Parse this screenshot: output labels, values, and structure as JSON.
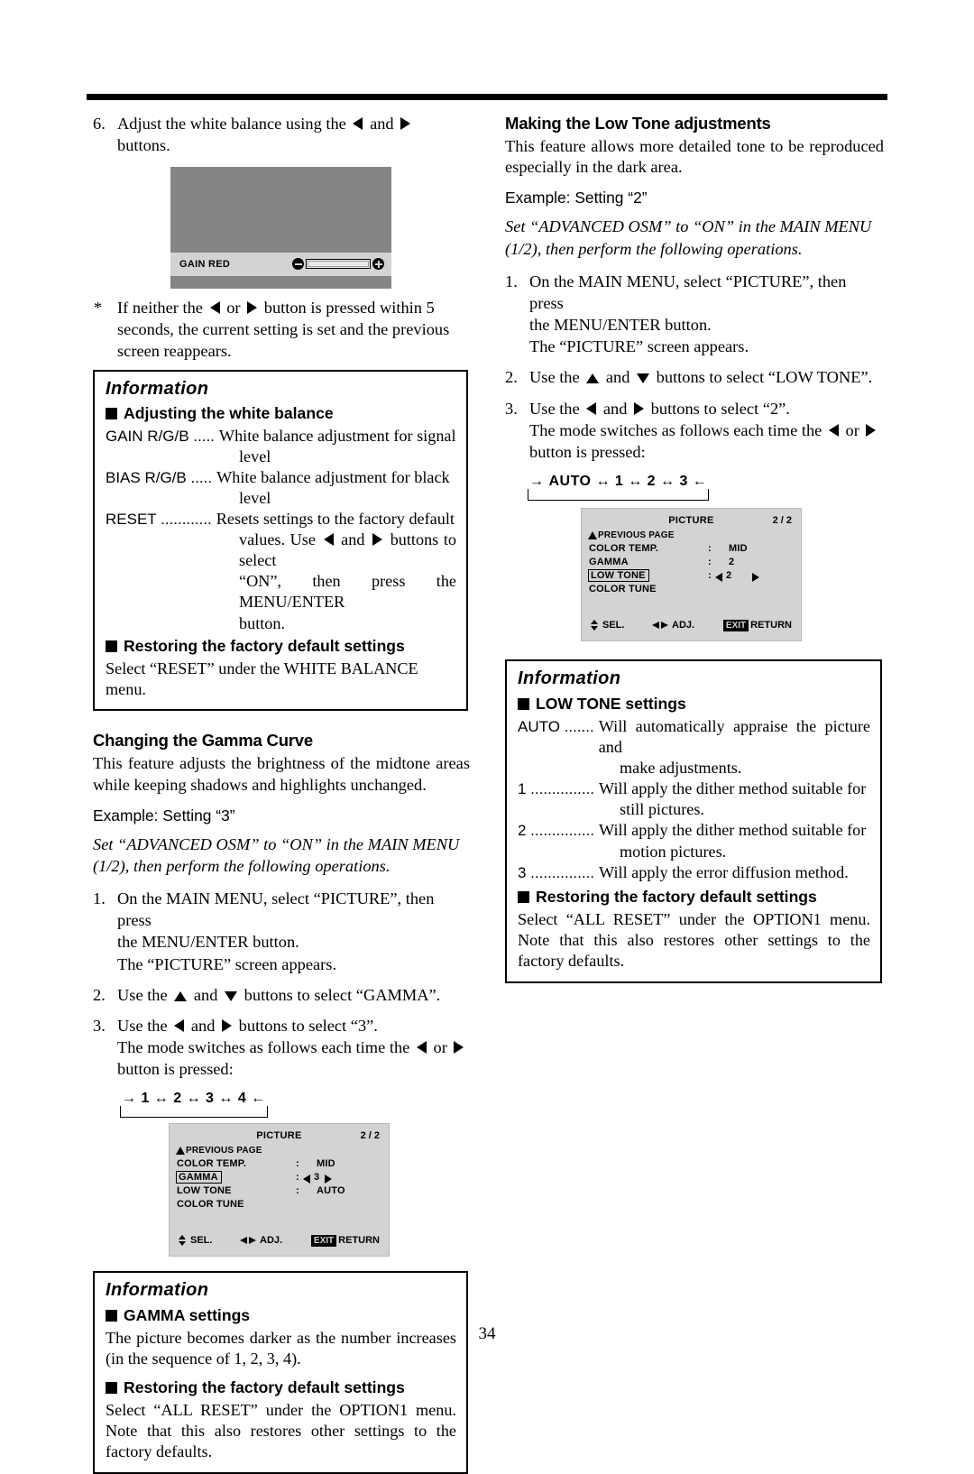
{
  "page": {
    "number": "34"
  },
  "left_column": {
    "step6": {
      "num": "6.",
      "text_a": "Adjust the white balance using the",
      "text_b": "and",
      "text_c": "buttons."
    },
    "gain_screen": {
      "label": "GAIN RED",
      "minus_icon": "minus-circle-icon",
      "plus_icon": "plus-circle-icon"
    },
    "star_note": {
      "star": "*",
      "line1_a": "If neither the",
      "line1_b": "or",
      "line1_c": "button is pressed within 5 seconds,",
      "line2": "the current setting is set and the previous screen reappears."
    },
    "info_white_balance": {
      "title": "Information",
      "heading": "Adjusting the white balance",
      "rows": [
        {
          "term": "GAIN R/G/B .....",
          "desc": "White balance adjustment for signal",
          "cont": "level"
        },
        {
          "term": "BIAS R/G/B .....",
          "desc": "White balance adjustment for black",
          "cont": "level"
        },
        {
          "term": "RESET ............",
          "desc": "Resets settings to the factory default",
          "cont2_a": "values. Use",
          "cont2_b": "and",
          "cont2_c": "buttons to select",
          "cont3": "“ON”, then press the MENU/ENTER",
          "cont4": "button."
        }
      ],
      "heading2": "Restoring the factory default settings",
      "body2": "Select “RESET” under the WHITE BALANCE menu."
    },
    "gamma_section": {
      "heading": "Changing the Gamma Curve",
      "intro": "This feature adjusts the brightness of the midtone areas while keeping shadows and highlights unchanged.",
      "example": "Example: Setting “3”",
      "italic_line1": "Set “ADVANCED OSM” to “ON” in the MAIN MENU",
      "italic_line2": "(1/2), then perform the following operations.",
      "steps": [
        {
          "num": "1.",
          "line1": "On the MAIN MENU, select “PICTURE”, then press",
          "line2": "the MENU/ENTER button.",
          "line3": "The “PICTURE” screen appears."
        },
        {
          "num": "2.",
          "a": "Use the",
          "b": "and",
          "c": "buttons to select “GAMMA”."
        },
        {
          "num": "3.",
          "a": "Use the",
          "b": "and",
          "c": "buttons to select “3”.",
          "d": "The mode switches as follows each time the",
          "e": "or",
          "f": "button is pressed:"
        }
      ],
      "sequence": "1 ↔ 2 ↔ 3 ↔ 4"
    },
    "osd_gamma": {
      "title": "PICTURE",
      "page": "2 / 2",
      "previous_page": "PREVIOUS PAGE",
      "rows": [
        {
          "label": "COLOR TEMP.",
          "colon": ":",
          "value": "MID",
          "highlight": false,
          "arrows": false
        },
        {
          "label": "GAMMA",
          "colon": ":",
          "value": "3",
          "highlight": true,
          "arrows": true
        },
        {
          "label": "LOW TONE",
          "colon": ":",
          "value": "AUTO",
          "highlight": false,
          "arrows": false
        },
        {
          "label": "COLOR TUNE",
          "colon": "",
          "value": "",
          "highlight": false,
          "arrows": false
        }
      ],
      "footer": {
        "sel": "SEL.",
        "adj": "ADJ.",
        "exit_chip": "EXIT",
        "return": "RETURN"
      }
    },
    "info_gamma": {
      "title": "Information",
      "heading": "GAMMA settings",
      "body": "The picture becomes darker as the number increases (in the sequence of 1, 2, 3, 4).",
      "heading2": "Restoring the factory default settings",
      "body2": "Select “ALL RESET” under the OPTION1 menu. Note that this also restores other settings to the factory defaults."
    }
  },
  "right_column": {
    "lowtone_section": {
      "heading": "Making the Low Tone adjustments",
      "intro": "This feature allows more detailed tone to be reproduced especially in the dark area.",
      "example": "Example: Setting “2”",
      "italic_line1": "Set “ADVANCED OSM” to “ON” in the MAIN MENU",
      "italic_line2": "(1/2), then perform the following operations.",
      "steps": [
        {
          "num": "1.",
          "line1": "On the MAIN MENU, select “PICTURE”, then press",
          "line2": "the MENU/ENTER button.",
          "line3": "The “PICTURE” screen appears."
        },
        {
          "num": "2.",
          "a": "Use the",
          "b": "and",
          "c": "buttons to select “LOW TONE”."
        },
        {
          "num": "3.",
          "a": "Use the",
          "b": "and",
          "c": "buttons to select “2”.",
          "d": "The mode switches as follows each time the",
          "e": "or",
          "f": "button is pressed:"
        }
      ],
      "sequence": "AUTO ↔ 1 ↔ 2 ↔ 3"
    },
    "osd_lowtone": {
      "title": "PICTURE",
      "page": "2 / 2",
      "previous_page": "PREVIOUS PAGE",
      "rows": [
        {
          "label": "COLOR TEMP.",
          "colon": ":",
          "value": "MID",
          "highlight": false,
          "arrows": false
        },
        {
          "label": "GAMMA",
          "colon": ":",
          "value": "2",
          "highlight": false,
          "arrows": false
        },
        {
          "label": "LOW TONE",
          "colon": ":",
          "value": "2",
          "highlight": true,
          "arrows": true
        },
        {
          "label": "COLOR TUNE",
          "colon": "",
          "value": "",
          "highlight": false,
          "arrows": false
        }
      ],
      "footer": {
        "sel": "SEL.",
        "adj": "ADJ.",
        "exit_chip": "EXIT",
        "return": "RETURN"
      }
    },
    "info_lowtone": {
      "title": "Information",
      "heading": "LOW TONE settings",
      "rows": [
        {
          "term": "AUTO .......",
          "desc": "Will automatically appraise the picture and",
          "cont": "make adjustments."
        },
        {
          "term": "1 ...............",
          "desc": "Will apply the dither method suitable for",
          "cont": "still pictures."
        },
        {
          "term": "2 ...............",
          "desc": "Will apply the dither method suitable for",
          "cont": "motion pictures."
        },
        {
          "term": "3 ...............",
          "desc": "Will apply the error diffusion method.",
          "cont": ""
        }
      ],
      "heading2": "Restoring the factory default settings",
      "body2": "Select “ALL RESET” under the OPTION1 menu. Note that this also restores other settings to the factory defaults."
    }
  }
}
